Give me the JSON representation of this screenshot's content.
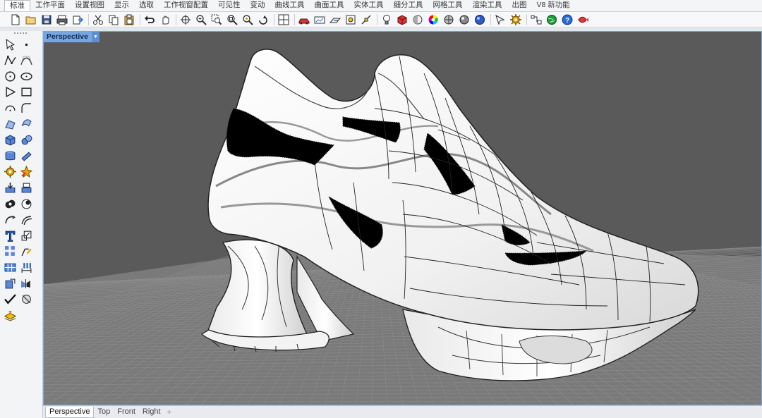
{
  "menu": {
    "tabs": [
      "标准",
      "工作平面",
      "设置视图",
      "显示",
      "选取",
      "工作视窗配置",
      "可见性",
      "变动",
      "曲线工具",
      "曲面工具",
      "实体工具",
      "细分工具",
      "网格工具",
      "渲染工具",
      "出图",
      "V8 新功能"
    ],
    "active_index": 0
  },
  "toolbar": {
    "icons": [
      "new-file-icon",
      "open-file-icon",
      "save-icon",
      "print-icon",
      "import-icon",
      "cut-icon",
      "copy-icon",
      "paste-icon",
      "undo-icon",
      "pan-hand-icon",
      "rotate-view-icon",
      "zoom-icon",
      "zoom-window-icon",
      "zoom-extents-icon",
      "zoom-selected-icon",
      "undo-view-icon",
      "four-viewports-icon",
      "car-icon",
      "named-views-icon",
      "named-cplane-icon",
      "properties-icon",
      "object-snap-icon",
      "light-bulb-icon",
      "shaded-icon",
      "material-icon",
      "color-wheel-icon",
      "sphere-render-icon",
      "render-icon",
      "world-sphere-icon",
      "arrow-icon",
      "options-gear-icon",
      "grasshopper-graph-icon",
      "globe-icon",
      "help-icon",
      "fish-icon"
    ]
  },
  "left_tools": {
    "icons": [
      "select-arrow-icon",
      "point-icon",
      "polyline-icon",
      "curve-cp-icon",
      "circle-icon",
      "ellipse-icon",
      "polygon-icon",
      "rectangle-icon",
      "arc-circle-icon",
      "fillet-curve-icon",
      "surface-from-points-icon",
      "extrude-surface-icon",
      "box-solid-icon",
      "sphere-solid-icon",
      "cylinder-solid-icon",
      "plane-solid-icon",
      "gear-subd-icon",
      "star-transform-icon",
      "split-icon",
      "trim-icon",
      "boolean-union-icon",
      "boolean-diff-icon",
      "join-curve-icon",
      "offset-curve-icon",
      "text-tool-icon",
      "scale-icon",
      "array-icon",
      "blend-icon",
      "mesh-grid-icon",
      "dimension-icon",
      "orient-icon",
      "mirror-icon",
      "check-icon",
      "edit-points-icon",
      "layer-icon"
    ]
  },
  "viewport": {
    "title": "Perspective",
    "dropdown": "▼"
  },
  "viewport_tabs": {
    "items": [
      "Perspective",
      "Top",
      "Front",
      "Right"
    ],
    "active_index": 0,
    "add_label": "+"
  },
  "colors": {
    "viewport_bg": "#5a5a5a",
    "selection_orange": "#f7a10d",
    "active_blue": "#7aa6e0"
  }
}
